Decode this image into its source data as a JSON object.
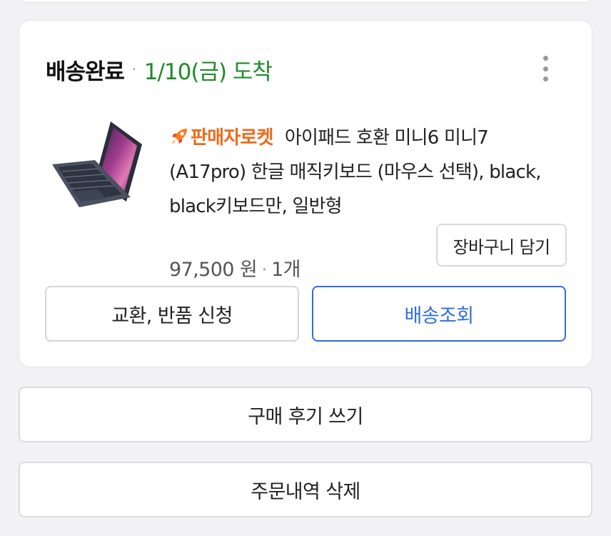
{
  "order": {
    "status_label": "배송완료",
    "separator": "·",
    "arrival": "1/10(금) 도착"
  },
  "product": {
    "badge": "판매자로켓",
    "title": "아이패드 호환 미니6 미니7 (A17pro) 한글 매직키보드 (마우스 선택), black, black키보드만, 일반형",
    "price": "97,500 원",
    "quantity": "1개",
    "icon": "rocket-icon"
  },
  "buttons": {
    "cart": "장바구니 담기",
    "exchange": "교환, 반품 신청",
    "track": "배송조회",
    "review": "구매 후기 쓰기",
    "delete": "주문내역 삭제"
  },
  "colors": {
    "arrival": "#1f8a2a",
    "badge": "#ef6a1b",
    "track_button": "#2f6de0"
  }
}
